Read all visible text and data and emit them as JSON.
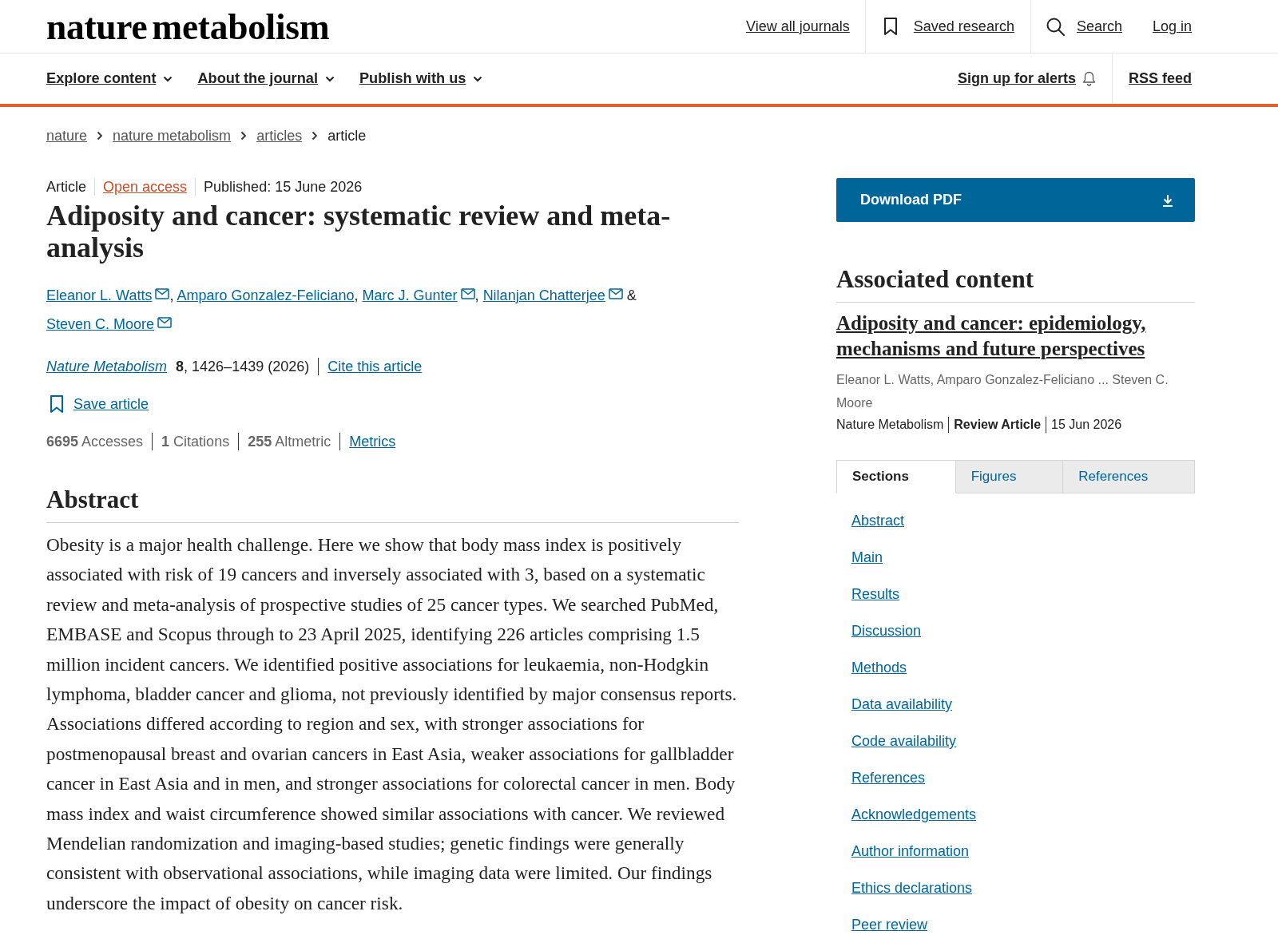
{
  "header": {
    "logo": "nature metabolism",
    "top_links": [
      {
        "label": "View all journals",
        "kind": "link"
      },
      {
        "label": "Saved research",
        "kind": "saved"
      },
      {
        "label": "Search",
        "kind": "search"
      },
      {
        "label": "Log in",
        "kind": "link"
      }
    ],
    "menu": [
      {
        "label": "Explore content"
      },
      {
        "label": "About the journal"
      },
      {
        "label": "Publish with us"
      }
    ],
    "secondary_links": [
      {
        "label": "Sign up for alerts",
        "kind": "alerts"
      },
      {
        "label": "RSS feed",
        "kind": "link"
      }
    ]
  },
  "breadcrumb": [
    {
      "label": "nature",
      "current": false
    },
    {
      "label": "nature metabolism",
      "current": false
    },
    {
      "label": "articles",
      "current": false
    },
    {
      "label": "article",
      "current": true
    }
  ],
  "article": {
    "type": "Article",
    "access": "Open access",
    "published": "Published: 15 June 2026",
    "title": "Adiposity and cancer: systematic review and meta-analysis",
    "authors": [
      {
        "name": "Eleanor L. Watts",
        "email": true,
        "joiner": ","
      },
      {
        "name": "Amparo Gonzalez-Feliciano",
        "email": false,
        "joiner": ","
      },
      {
        "name": "Marc J. Gunter",
        "email": true,
        "joiner": ","
      },
      {
        "name": "Nilanjan Chatterjee",
        "email": true,
        "joiner": " &"
      },
      {
        "name": "Steven C. Moore",
        "email": true
      }
    ],
    "journal": "Nature Metabolism",
    "citation": "**8**, 1426–1439 (2026)",
    "cite_link": "Cite this article",
    "save_link": "Save article",
    "metrics": [
      "**6695** Accesses",
      "**1** Citations",
      "**255** Altmetric"
    ],
    "metrics_link": "Metrics",
    "abstract": {
      "heading": "Abstract",
      "text": "Obesity is a major health challenge. Here we show that body mass index is positively associated with risk of 19 cancers and inversely associated with 3, based on a systematic review and meta-analysis of prospective studies of 25 cancer types. We searched PubMed, EMBASE and Scopus through to 23 April 2025, identifying 226 articles comprising 1.5 million incident cancers. We identified positive associations for leukaemia, non-Hodgkin lymphoma, bladder cancer and glioma, not previously identified by major consensus reports. Associations differed according to region and sex, with stronger associations for postmenopausal breast and ovarian cancers in East Asia, weaker associations for gallbladder cancer in East Asia and in men, and stronger associations for colorectal cancer in men. Body mass index and waist circumference showed similar associations with cancer. We reviewed Mendelian randomization and imaging-based studies; genetic findings were generally consistent with observational associations, while imaging data were limited. Our findings underscore the impact of obesity on cancer risk."
    }
  },
  "sidebar": {
    "download_button": "Download PDF",
    "associated": {
      "heading": "Associated content",
      "title": "Adiposity and cancer: epidemiology, mechanisms and future perspectives",
      "authors": "Eleanor L. Watts, Amparo Gonzalez-Feliciano ... Steven C. Moore",
      "journal": "Nature Metabolism",
      "type": "Review Article",
      "date": "15 Jun 2026"
    },
    "tabs": [
      {
        "label": "Sections",
        "selected": true
      },
      {
        "label": "Figures",
        "selected": false
      },
      {
        "label": "References",
        "selected": false
      }
    ],
    "sections": [
      "Abstract",
      "Main",
      "Results",
      "Discussion",
      "Methods",
      "Data availability",
      "Code availability",
      "References",
      "Acknowledgements",
      "Author information",
      "Ethics declarations",
      "Peer review"
    ]
  }
}
